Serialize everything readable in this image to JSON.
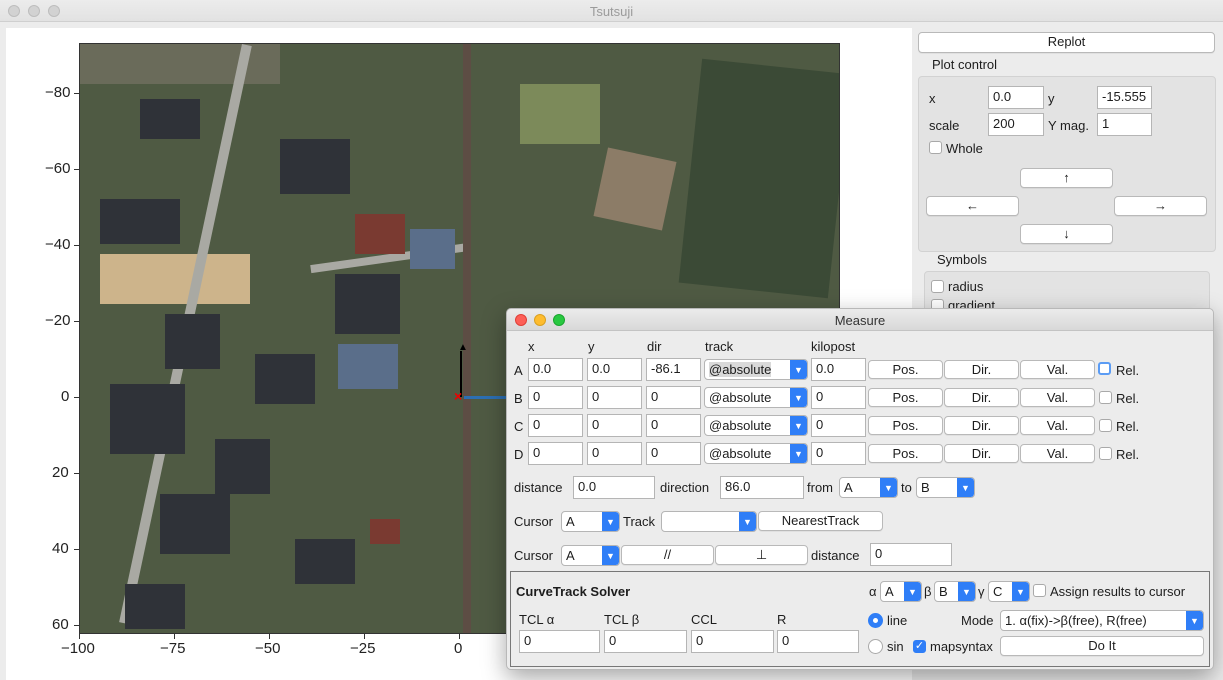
{
  "window": {
    "title": "Tsutsuji"
  },
  "plot": {
    "y_ticks": [
      "−80",
      "−60",
      "−40",
      "−20",
      "0",
      "20",
      "40",
      "60"
    ],
    "x_ticks": [
      "−100",
      "−75",
      "−50",
      "−25",
      "0"
    ],
    "cursor_symbol": "×"
  },
  "side": {
    "replot_label": "Replot",
    "plot_control_label": "Plot control",
    "x_label": "x",
    "x_value": "0.0",
    "y_label": "y",
    "y_value": "-15.555",
    "scale_label": "scale",
    "scale_value": "200",
    "ymag_label": "Y mag.",
    "ymag_value": "1",
    "whole_label": "Whole",
    "up_label": "↑",
    "left_label": "←",
    "right_label": "→",
    "down_label": "↓",
    "symbols_label": "Symbols",
    "radius_label": "radius",
    "gradient_label": "gradient"
  },
  "measure": {
    "title": "Measure",
    "headers": {
      "x": "x",
      "y": "y",
      "dir": "dir",
      "track": "track",
      "kilopost": "kilopost"
    },
    "rows": [
      {
        "name": "A",
        "x": "0.0",
        "y": "0.0",
        "dir": "-86.1",
        "track": "@absolute",
        "kilopost": "0.0"
      },
      {
        "name": "B",
        "x": "0",
        "y": "0",
        "dir": "0",
        "track": "@absolute",
        "kilopost": "0"
      },
      {
        "name": "C",
        "x": "0",
        "y": "0",
        "dir": "0",
        "track": "@absolute",
        "kilopost": "0"
      },
      {
        "name": "D",
        "x": "0",
        "y": "0",
        "dir": "0",
        "track": "@absolute",
        "kilopost": "0"
      }
    ],
    "pos_label": "Pos.",
    "dir_label": "Dir.",
    "val_label": "Val.",
    "rel_label": "Rel.",
    "distance_label": "distance",
    "distance_value": "0.0",
    "direction_label": "direction",
    "direction_value": "86.0",
    "from_label": "from",
    "from_value": "A",
    "to_label": "to",
    "to_value": "B",
    "cursor_label": "Cursor",
    "cursor1_value": "A",
    "track_label": "Track",
    "track_value": "",
    "nearest_label": "NearestTrack",
    "cursor2_value": "A",
    "parallel_label": "//",
    "perp_label": "⊥",
    "distance2_label": "distance",
    "distance2_value": "0",
    "solver": {
      "title": "CurveTrack Solver",
      "alpha_label": "α",
      "alpha_value": "A",
      "beta_label": "β",
      "beta_value": "B",
      "gamma_label": "γ",
      "gamma_value": "C",
      "assign_label": "Assign results to cursor",
      "tcl_a_label": "TCL α",
      "tcl_a_value": "0",
      "tcl_b_label": "TCL β",
      "tcl_b_value": "0",
      "ccl_label": "CCL",
      "ccl_value": "0",
      "r_label": "R",
      "r_value": "0",
      "line_label": "line",
      "sin_label": "sin",
      "mode_label": "Mode",
      "mode_value": "1. α(fix)->β(free), R(free)",
      "mapsyntax_label": "mapsyntax",
      "doit_label": "Do It"
    }
  }
}
